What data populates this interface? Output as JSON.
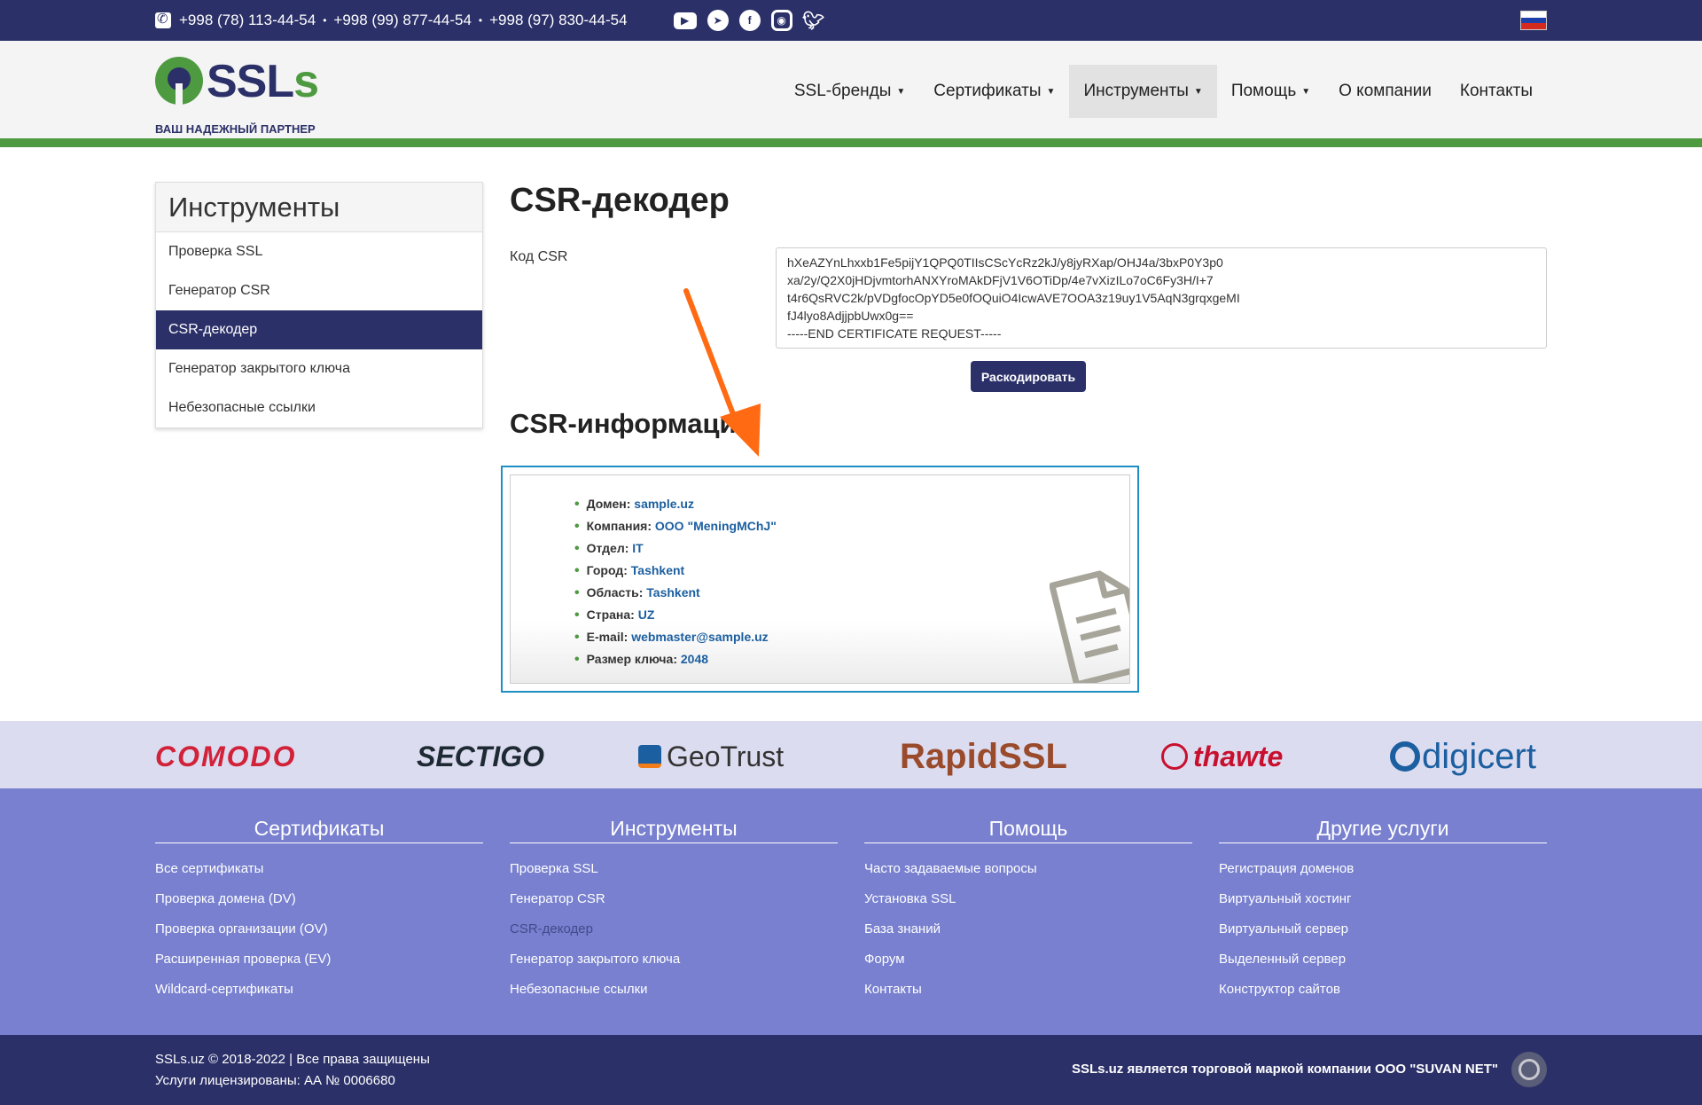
{
  "topbar": {
    "phones": [
      "+998 (78) 113-44-54",
      "+998 (99) 877-44-54",
      "+998 (97) 830-44-54"
    ],
    "socials": [
      "youtube-icon",
      "telegram-icon",
      "facebook-icon",
      "instagram-icon",
      "twitter-icon"
    ],
    "language_flag": "russian-flag-icon"
  },
  "header": {
    "logo_text_main": "SSL",
    "logo_text_accent": "s",
    "logo_tagline": "ВАШ НАДЕЖНЫЙ ПАРТНЕР",
    "nav": [
      {
        "label": "SSL-бренды",
        "dropdown": true
      },
      {
        "label": "Сертификаты",
        "dropdown": true
      },
      {
        "label": "Инструменты",
        "dropdown": true,
        "active": true
      },
      {
        "label": "Помощь",
        "dropdown": true
      },
      {
        "label": "О компании",
        "dropdown": false
      },
      {
        "label": "Контакты",
        "dropdown": false
      }
    ],
    "accent_color": "#4e9a41",
    "brand_color": "#2b3068"
  },
  "sidebar": {
    "title": "Инструменты",
    "items": [
      {
        "label": "Проверка SSL"
      },
      {
        "label": "Генератор CSR"
      },
      {
        "label": "CSR-декодер",
        "active": true
      },
      {
        "label": "Генератор закрытого ключа"
      },
      {
        "label": "Небезопасные ссылки"
      }
    ]
  },
  "main": {
    "title": "CSR-декодер",
    "csr_label": "Код CSR",
    "csr_lines": [
      "hXeAZYnLhxxb1Fe5pijY1QPQ0TIIsCScYcRz2kJ/y8jyRXap/OHJ4a/3bxP0Y3p0",
      "xa/2y/Q2X0jHDjvmtorhANXYroMAkDFjV1V6OTiDp/4e7vXizILo7oC6Fy3H/I+7",
      "t4r6QsRVC2k/pVDgfocOpYD5e0fOQuiO4IcwAVE7OOA3z19uy1V5AqN3grqxgeMI",
      "fJ4lyo8AdjjpbUwx0g==",
      "-----END CERTIFICATE REQUEST-----"
    ],
    "decode_button": "Раскодировать",
    "info_title": "CSR-информация",
    "info": [
      {
        "label": "Домен:",
        "value": "sample.uz"
      },
      {
        "label": "Компания:",
        "value": "ООО \"MeningMChJ\""
      },
      {
        "label": "Отдел:",
        "value": "IT"
      },
      {
        "label": "Город:",
        "value": "Tashkent"
      },
      {
        "label": "Область:",
        "value": "Tashkent"
      },
      {
        "label": "Страна:",
        "value": "UZ"
      },
      {
        "label": "E-mail:",
        "value": "webmaster@sample.uz"
      },
      {
        "label": "Размер ключа:",
        "value": "2048"
      }
    ]
  },
  "brands": [
    "COMODO",
    "SECTIGO",
    "GeoTrust",
    "RapidSSL",
    "thawte",
    "digicert"
  ],
  "footer": {
    "columns": [
      {
        "title": "Сертификаты",
        "links": [
          "Все сертификаты",
          "Проверка домена (DV)",
          "Проверка организации (OV)",
          "Расширенная проверка (EV)",
          "Wildcard-сертификаты"
        ]
      },
      {
        "title": "Инструменты",
        "links": [
          "Проверка SSL",
          "Генератор CSR",
          "CSR-декодер",
          "Генератор закрытого ключа",
          "Небезопасные ссылки"
        ]
      },
      {
        "title": "Помощь",
        "links": [
          "Часто задаваемые вопросы",
          "Установка SSL",
          "База знаний",
          "Форум",
          "Контакты"
        ]
      },
      {
        "title": "Другие услуги",
        "links": [
          "Регистрация доменов",
          "Виртуальный хостинг",
          "Виртуальный сервер",
          "Выделенный сервер",
          "Конструктор сайтов"
        ]
      }
    ],
    "copyright": "SSLs.uz © 2018-2022 | Все права защищены",
    "license": "Услуги лицензированы: АА № 0006680",
    "trademark": "SSLs.uz является торговой маркой компании ООО \"SUVAN NET\""
  }
}
